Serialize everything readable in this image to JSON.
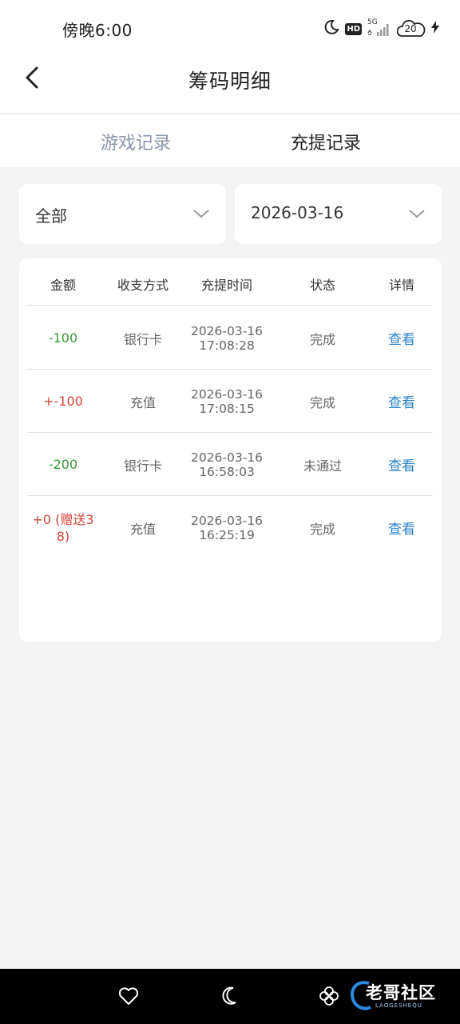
{
  "status_bar": {
    "time": "傍晚6:00",
    "hd": "HD",
    "network": "5G",
    "battery": "20"
  },
  "header": {
    "title": "筹码明细"
  },
  "tabs": [
    {
      "label": "游戏记录",
      "active": false
    },
    {
      "label": "充提记录",
      "active": true
    }
  ],
  "filters": {
    "type": "全部",
    "date": "2026-03-16"
  },
  "table": {
    "headers": [
      "金额",
      "收支方式",
      "充提时间",
      "状态",
      "详情"
    ],
    "rows": [
      {
        "amount": "-100",
        "method": "银行卡",
        "date": "2026-03-16",
        "time": "17:08:28",
        "status": "完成",
        "detail": "查看"
      },
      {
        "amount": "+-100",
        "method": "充值",
        "date": "2026-03-16",
        "time": "17:08:15",
        "status": "完成",
        "detail": "查看"
      },
      {
        "amount": "-200",
        "method": "银行卡",
        "date": "2026-03-16",
        "time": "16:58:03",
        "status": "未通过",
        "detail": "查看"
      },
      {
        "amount_line1": "+0 (赠送3",
        "amount_line2": "8)",
        "method": "充值",
        "date": "2026-03-16",
        "time": "16:25:19",
        "status": "完成",
        "detail": "查看"
      }
    ]
  },
  "colors": {
    "negative": "#3a9b36",
    "positive": "#d8443a",
    "link": "#2a82c9",
    "inactive_tab": "#8a96ab"
  },
  "watermark": {
    "text": "老哥社区",
    "sub": "LAOGESHEQU"
  }
}
